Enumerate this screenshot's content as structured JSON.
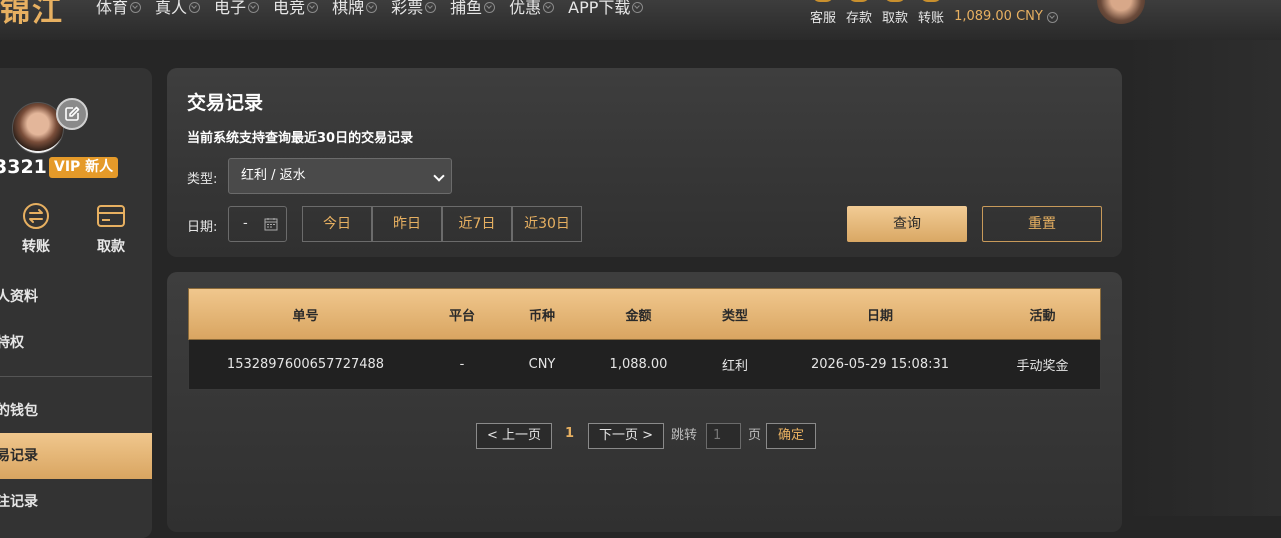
{
  "header": {
    "logo_text": "锦江",
    "nav": [
      "体育",
      "真人",
      "电子",
      "电竞",
      "棋牌",
      "彩票",
      "捕鱼",
      "优惠",
      "APP下载"
    ],
    "quick_links": [
      "客服",
      "存款",
      "取款",
      "转账"
    ],
    "balance": "1,089.00 CNY"
  },
  "sidebar": {
    "username": "3321",
    "vip_badge": "VIP 新人",
    "actions": [
      {
        "label": "转账",
        "icon": "transfer-icon"
      },
      {
        "label": "取款",
        "icon": "card-icon"
      }
    ],
    "menu": [
      {
        "label": "人资料",
        "active": false
      },
      {
        "label": "特权",
        "active": false
      },
      {
        "label": "的钱包",
        "active": false
      },
      {
        "label": "易记录",
        "active": true
      },
      {
        "label": "注记录",
        "active": false
      }
    ]
  },
  "filters": {
    "title": "交易记录",
    "subtitle": "当前系统支持查询最近30日的交易记录",
    "type_label": "类型:",
    "type_value": "红利 / 返水",
    "date_label": "日期:",
    "date_value": "-",
    "quick_ranges": [
      "今日",
      "昨日",
      "近7日",
      "近30日"
    ],
    "query_label": "查询",
    "reset_label": "重置"
  },
  "table": {
    "headers": [
      "单号",
      "平台",
      "币种",
      "金额",
      "类型",
      "日期",
      "活動"
    ],
    "rows": [
      [
        "1532897600657727488",
        "-",
        "CNY",
        "1,088.00",
        "红利",
        "2026-05-29 15:08:31",
        "手动奖金"
      ]
    ]
  },
  "pagination": {
    "prev_label": "< 上一页",
    "current_page": "1",
    "next_label": "下一页 >",
    "jump_label": "跳转",
    "jump_value": "1",
    "page_suffix": "页",
    "confirm_label": "确定"
  },
  "colors": {
    "accent": "#e7b061",
    "gold_gradient_top": "#f0c78d",
    "gold_gradient_bottom": "#d9a561",
    "vip_badge": "#e59a29"
  }
}
